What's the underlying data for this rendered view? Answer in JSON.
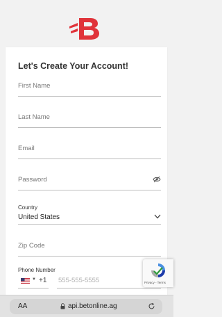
{
  "brand": {
    "logo_letter": "B",
    "accent_color": "#e0333a"
  },
  "form": {
    "title": "Let's Create Your Account!",
    "first_name_placeholder": "First Name",
    "last_name_placeholder": "Last Name",
    "email_placeholder": "Email",
    "password_placeholder": "Password",
    "country_label": "Country",
    "country_value": "United States",
    "zip_placeholder": "Zip Code",
    "phone_label": "Phone Number",
    "dial_code": "+1",
    "phone_placeholder": "555-555-5555"
  },
  "recaptcha": {
    "links": "Privacy - Terms"
  },
  "browser": {
    "aa_label": "AA",
    "url": "api.betonline.ag"
  },
  "icons": {
    "logo": "betonline-logo-icon",
    "password_toggle": "eye-slash-icon",
    "country_dropdown": "chevron-down-icon",
    "flag": "us-flag-icon",
    "recaptcha": "recaptcha-icon",
    "lock": "lock-icon",
    "reload": "reload-icon"
  }
}
